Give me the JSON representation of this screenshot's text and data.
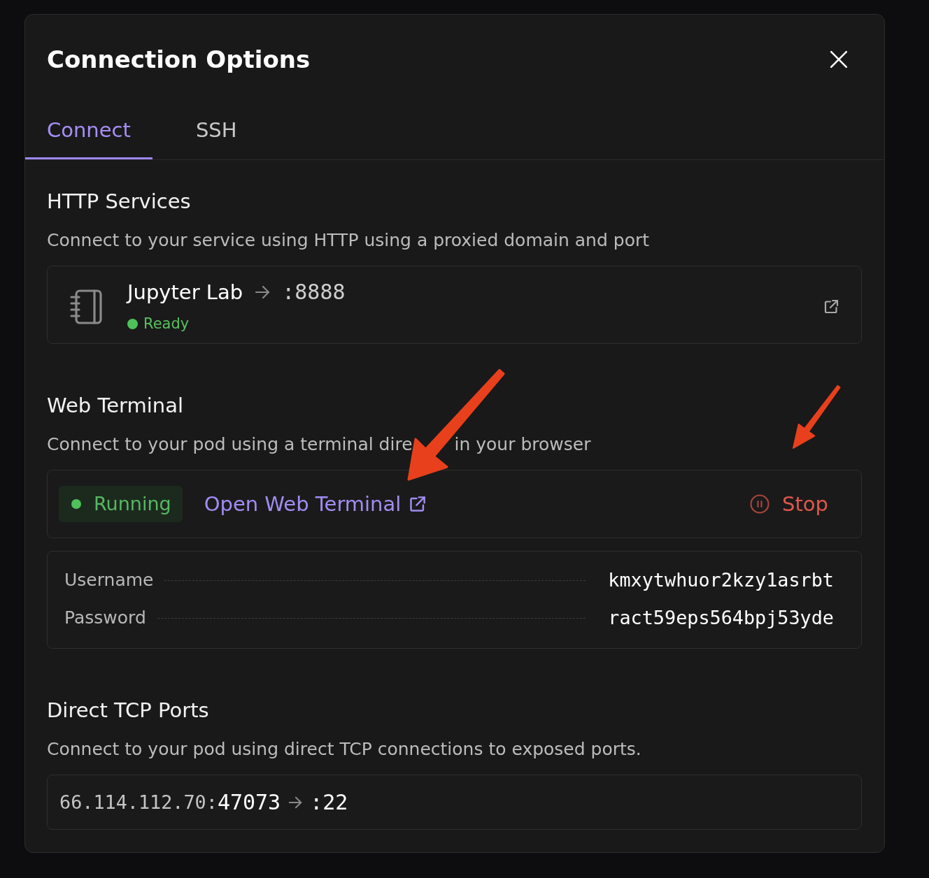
{
  "dialog": {
    "title": "Connection Options"
  },
  "tabs": [
    {
      "label": "Connect",
      "selected": true
    },
    {
      "label": "SSH",
      "selected": false
    }
  ],
  "http_services": {
    "title": "HTTP Services",
    "description": "Connect to your service using HTTP using a proxied domain and port",
    "services": [
      {
        "name": "Jupyter Lab",
        "port": ":8888",
        "status": "Ready"
      }
    ]
  },
  "web_terminal": {
    "title": "Web Terminal",
    "description_parts": [
      "Connect to your pod using a terminal dire",
      "in your browser"
    ],
    "status": "Running",
    "link": "Open Web Terminal",
    "stop": "Stop",
    "credentials": [
      {
        "label": "Username",
        "value": "kmxytwhuor2kzy1asrbt"
      },
      {
        "label": "Password",
        "value": "ract59eps564bpj53yde"
      }
    ]
  },
  "direct_tcp_ports": {
    "title": "Direct TCP Ports",
    "description": "Connect to your pod using direct TCP connections to exposed ports.",
    "ports": [
      {
        "address": "66.114.112.70:",
        "public_port": "47073",
        "internal_port": ":22"
      }
    ]
  }
}
